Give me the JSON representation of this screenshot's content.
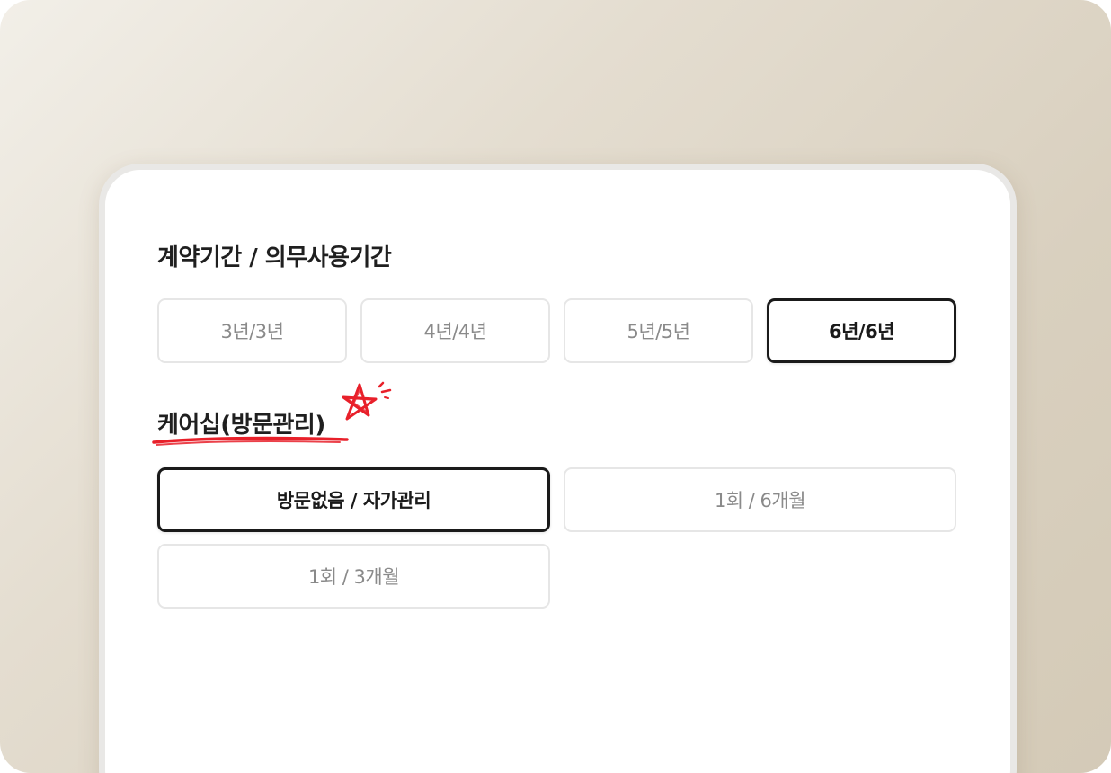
{
  "contract": {
    "title": "계약기간 / 의무사용기간",
    "options": [
      "3년/3년",
      "4년/4년",
      "5년/5년",
      "6년/6년"
    ],
    "selected_index": 3
  },
  "care": {
    "title": "케어십(방문관리)",
    "options": [
      "방문없음 / 자가관리",
      "1회 / 6개월",
      "1회 / 3개월"
    ],
    "selected_index": 0
  },
  "colors": {
    "accent_red": "#e8202a",
    "selected_border": "#1a1a1a",
    "unselected_text": "#8a8a8a"
  }
}
